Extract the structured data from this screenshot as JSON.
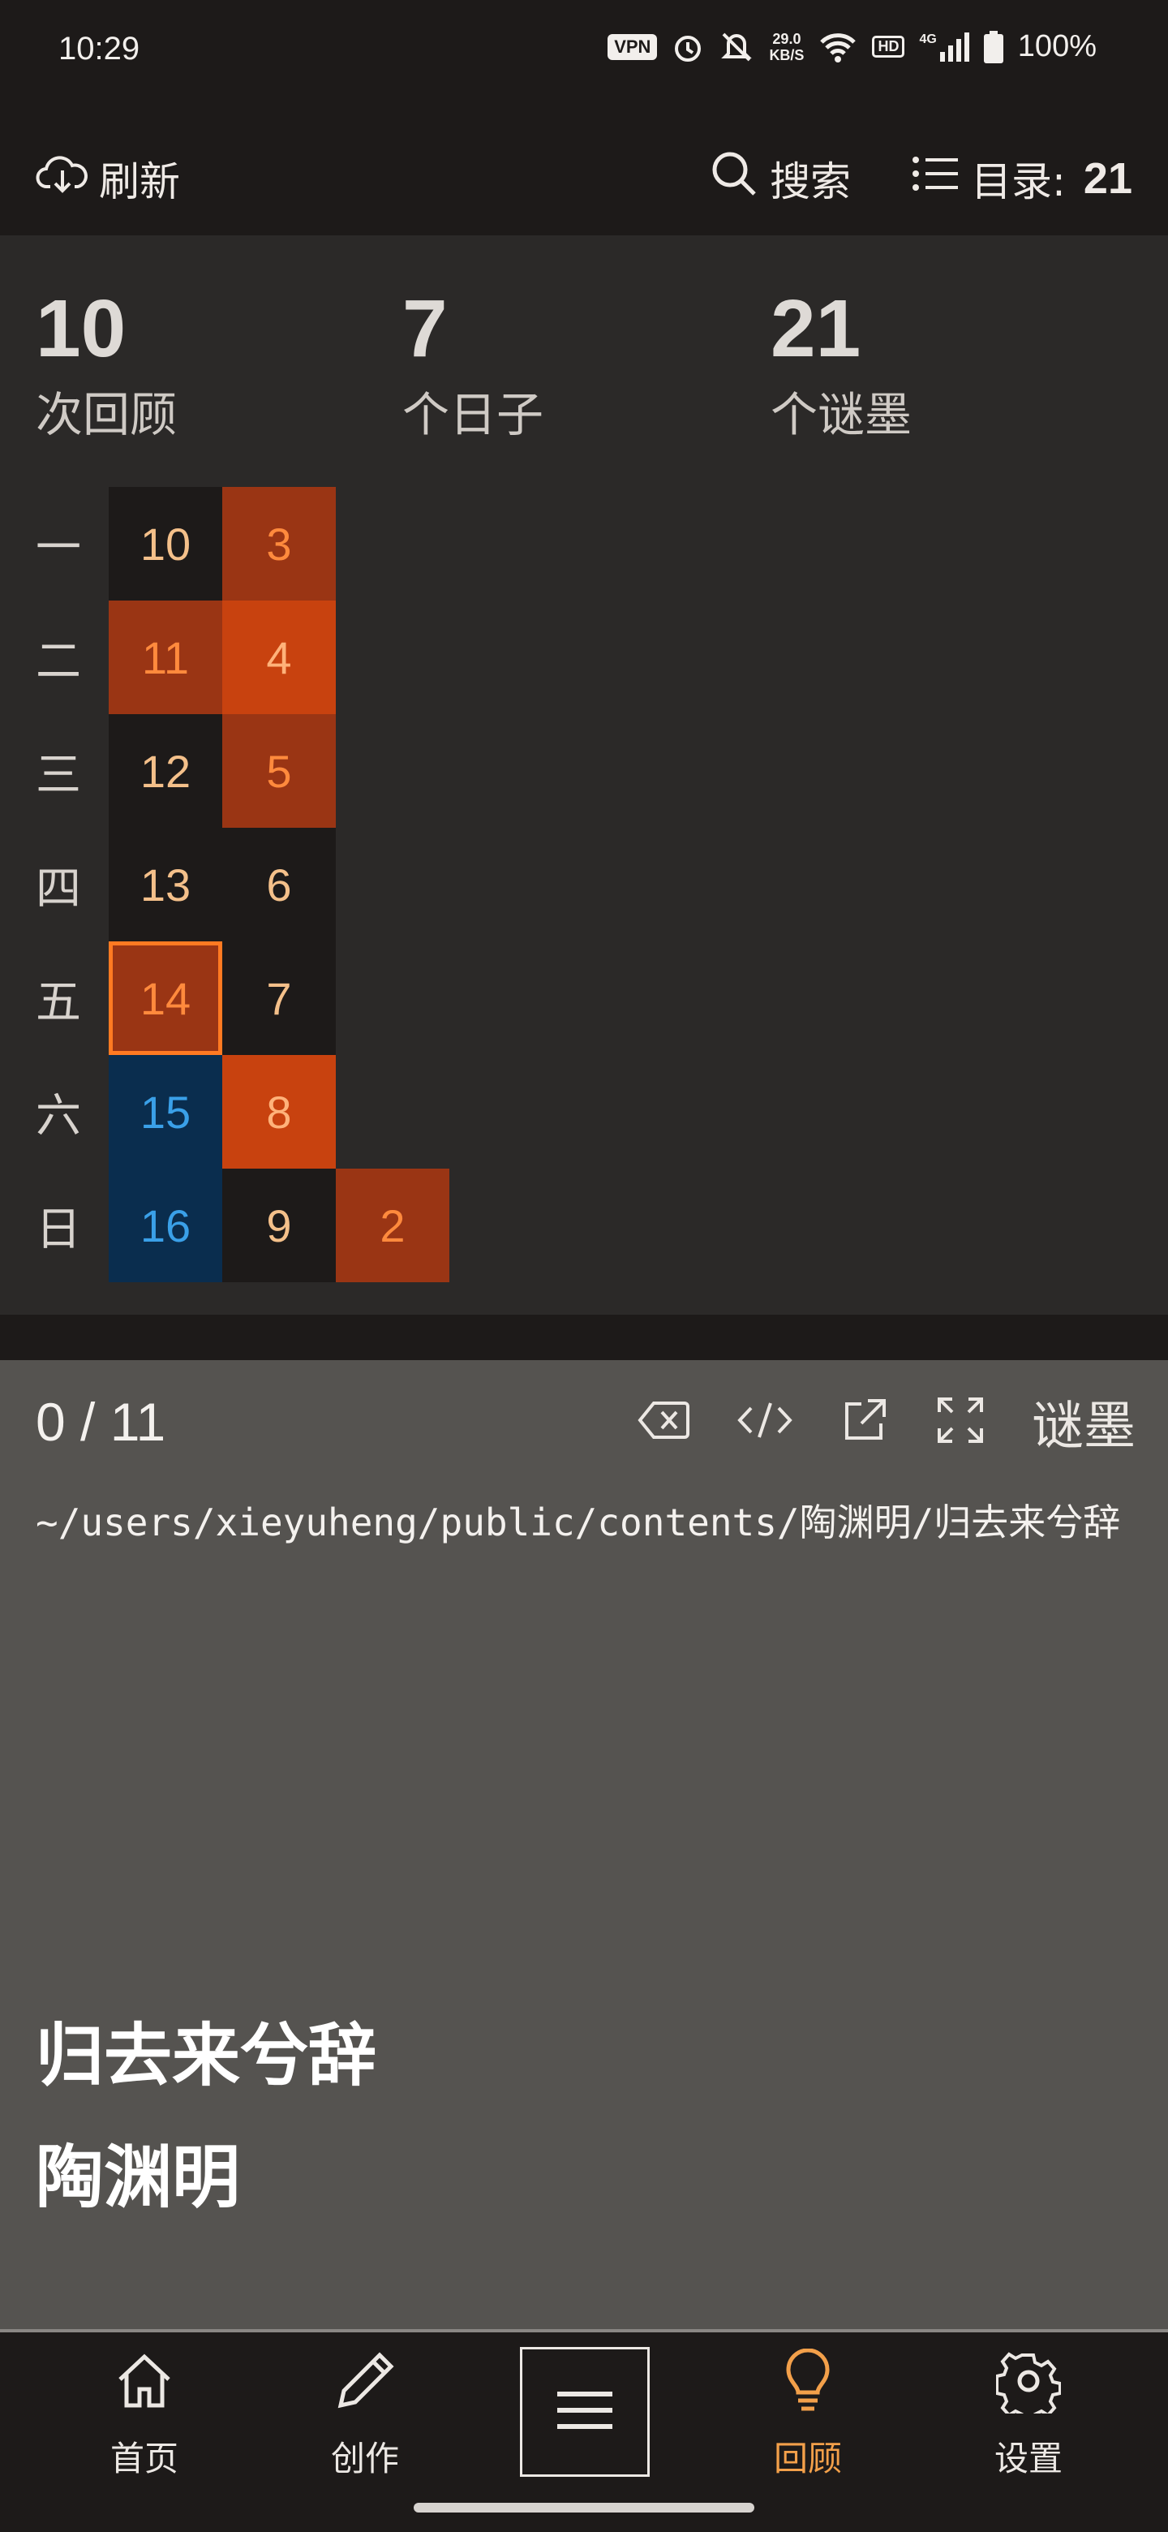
{
  "status_bar": {
    "time": "10:29",
    "vpn": "VPN",
    "speed_value": "29.0",
    "speed_unit": "KB/S",
    "hd": "HD",
    "network": "4G",
    "battery": "100%"
  },
  "toolbar": {
    "refresh_label": "刷新",
    "search_label": "搜索",
    "catalog_label": "目录:",
    "catalog_count": "21"
  },
  "stats": {
    "reviews": {
      "value": "10",
      "label": "次回顾"
    },
    "days": {
      "value": "7",
      "label": "个日子"
    },
    "riddles": {
      "value": "21",
      "label": "个谜墨"
    }
  },
  "calendar": {
    "weekdays": [
      "一",
      "二",
      "三",
      "四",
      "五",
      "六",
      "日"
    ],
    "columns": [
      [
        "10",
        "11",
        "12",
        "13",
        "14",
        "15",
        "16"
      ],
      [
        "3",
        "4",
        "5",
        "6",
        "7",
        "8",
        "9"
      ],
      [
        "",
        "",
        "",
        "",
        "",
        "",
        "2"
      ]
    ],
    "selected": "14"
  },
  "reader": {
    "counter": "0 / 11",
    "tag": "谜墨",
    "path": "~/users/xieyuheng/public/contents/陶渊明/归去来兮辞",
    "title": "归去来兮辞",
    "author": "陶渊明"
  },
  "bottom_nav": {
    "home": "首页",
    "create": "创作",
    "review": "回顾",
    "settings": "设置"
  },
  "colors": {
    "accent": "#f3a04a",
    "heat_low": "#9a3514",
    "heat_high": "#c8420f",
    "future": "#0a2d4e",
    "selected_outline": "#ff7a22"
  }
}
